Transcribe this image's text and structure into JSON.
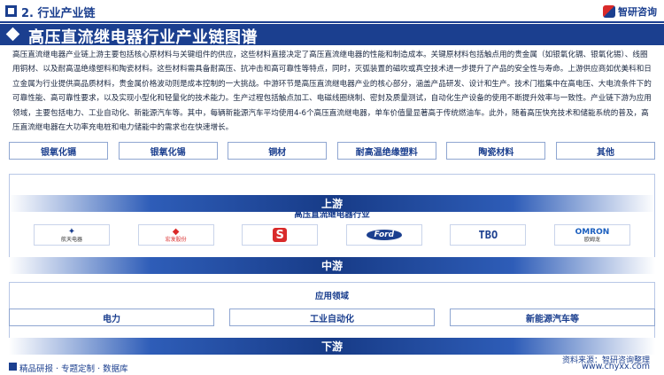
{
  "header": {
    "section": "2. 行业产业链",
    "brand": "智研咨询"
  },
  "title": "高压直流继电器行业产业链图谱",
  "description": "高压直流继电器产业链上游主要包括核心原材料与关键组件的供应，这些材料直接决定了高压直流继电器的性能和制造成本。关键原材料包括触点用的贵金属（如银氧化镉、银氧化锡）、线圈用铜材、以及耐高温绝缘塑料和陶瓷材料。这些材料需具备耐高压、抗冲击和高可靠性等特点，同时，灭弧装置的磁吹或真空技术进一步提升了产品的安全性与寿命。上游供应商如优美科和日立金属为行业提供高品质材料，贵金属价格波动则是成本控制的一大挑战。中游环节是高压直流继电器产业的核心部分，涵盖产品研发、设计和生产。技术门槛集中在高电压、大电流条件下的可靠性能、高可靠性要求，以及实现小型化和轻量化的技术能力。生产过程包括触点加工、电磁线圈绕制、密封及质量测试，自动化生产设备的使用不断提升效率与一致性。产业链下游为应用领域，主要包括电力、工业自动化、新能源汽车等。其中，每辆新能源汽车平均使用4-6个高压直流继电器，单车价值量显著高于传统燃油车。此外，随着高压快充技术和储能系统的普及，高压直流继电器在大功率充电桩和电力储能中的需求也在快速增长。",
  "upstream": {
    "label": "上游",
    "items": [
      "银氧化镉",
      "银氧化锡",
      "铜材",
      "耐高温绝缘塑料",
      "陶瓷材料",
      "其他"
    ]
  },
  "midstream": {
    "label": "中游",
    "sublabel": "高压直流继电器行业",
    "companies": [
      {
        "mark": "✦",
        "name": "航天电器",
        "color": "#1b3f8f"
      },
      {
        "mark": "◆",
        "name": "宏发股份",
        "color": "#d92a2a"
      },
      {
        "mark": "S",
        "name": "",
        "color": "#d92a2a"
      },
      {
        "mark": "Ford",
        "name": "",
        "color": "#1b3f8f"
      },
      {
        "mark": "TBO",
        "name": "",
        "color": "#1b3f8f"
      },
      {
        "mark": "OMRON",
        "name": "欧姆龙",
        "color": "#1b5fbf"
      }
    ]
  },
  "downstream": {
    "label": "下游",
    "sublabel": "应用领域",
    "items": [
      "电力",
      "工业自动化",
      "新能源汽车等"
    ]
  },
  "footer": {
    "left": "精品研报 · 专题定制 · 数据库",
    "right": "www.chyxx.com",
    "source": "资料来源：智研咨询整理"
  }
}
